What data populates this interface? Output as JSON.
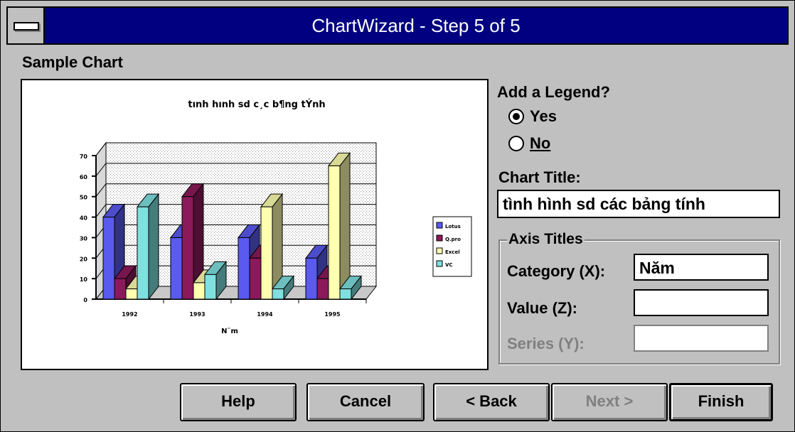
{
  "window": {
    "title": "ChartWizard - Step 5 of 5"
  },
  "sample_chart": {
    "label": "Sample Chart",
    "chart_title": "tınh hınh sd c¸c b¶ng tÝnh",
    "x_axis_label": "N¨m",
    "legend": [
      "Lotus",
      "Q.pro",
      "Excel",
      "VC"
    ]
  },
  "chart_data": {
    "type": "bar",
    "title": "tınh hınh sd c¸c b¶ng tÝnh",
    "xlabel": "N¨m",
    "ylabel": "",
    "categories": [
      "1992",
      "1993",
      "1994",
      "1995"
    ],
    "series": [
      {
        "name": "Lotus",
        "values": [
          40,
          30,
          30,
          20
        ]
      },
      {
        "name": "Q.pro",
        "values": [
          10,
          50,
          20,
          10
        ]
      },
      {
        "name": "Excel",
        "values": [
          5,
          8,
          45,
          65
        ]
      },
      {
        "name": "VC",
        "values": [
          45,
          12,
          5,
          5
        ]
      }
    ],
    "yticks": [
      "0",
      "10",
      "20",
      "30",
      "40",
      "50",
      "60",
      "70"
    ],
    "ylim": [
      0,
      70
    ],
    "grid": true,
    "legend_position": "right",
    "colors": [
      "#5a5af0",
      "#8b1a5a",
      "#ffffb0",
      "#80e0e0"
    ]
  },
  "legend_section": {
    "label": "Add a Legend?",
    "yes": "Yes",
    "no": "No",
    "selected": "Yes"
  },
  "chart_title_field": {
    "label": "Chart Title:",
    "value": "tình hình sd các bảng tính"
  },
  "axis_titles": {
    "label": "Axis Titles",
    "category": {
      "label": "Category (X):",
      "value": "Năm"
    },
    "value": {
      "label": "Value (Z):",
      "value": ""
    },
    "series": {
      "label": "Series (Y):",
      "value": ""
    }
  },
  "buttons": {
    "help": "Help",
    "cancel": "Cancel",
    "back": "< Back",
    "next": "Next >",
    "finish": "Finish"
  }
}
